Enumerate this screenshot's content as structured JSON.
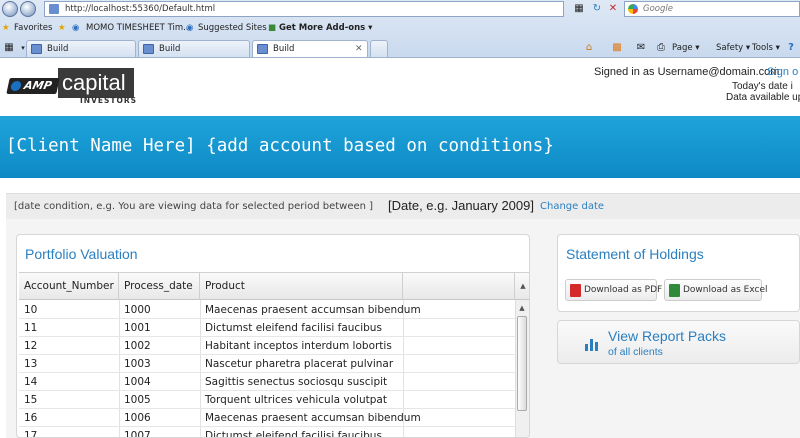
{
  "browser": {
    "address": "http://localhost:55360/Default.html",
    "search_placeholder": "Google",
    "favorites_label": "Favorites",
    "bookmarks": [
      "MOMO  TIMESHEET  Tim...",
      "Suggested Sites ▾",
      "Get More Add-ons ▾"
    ],
    "tabs": [
      "Build",
      "Build",
      "Build"
    ],
    "commands": [
      "Page ▾",
      "Safety ▾",
      "Tools ▾"
    ]
  },
  "header": {
    "logo_amp": "AMP",
    "logo_capital": "capital",
    "logo_investors": "INVESTORS",
    "signed_in": "Signed in as  Username@domain.com",
    "sign_out": "Sign o",
    "today": "Today's date i",
    "available": "Data available up t"
  },
  "banner": {
    "title": "[Client Name Here] {add account based on conditions}"
  },
  "date_bar": {
    "condition": "[date condition, e.g. You are viewing data for selected period between ]",
    "date": "[Date, e.g. January 2009]",
    "change": "Change date"
  },
  "portfolio": {
    "title": "Portfolio Valuation",
    "columns": [
      "Account_Number",
      "Process_date",
      "Product"
    ],
    "rows": [
      [
        "10",
        "1000",
        "Maecenas praesent accumsan bibendum"
      ],
      [
        "11",
        "1001",
        "Dictumst eleifend facilisi faucibus"
      ],
      [
        "12",
        "1002",
        "Habitant inceptos interdum lobortis"
      ],
      [
        "13",
        "1003",
        "Nascetur pharetra placerat pulvinar"
      ],
      [
        "14",
        "1004",
        "Sagittis senectus sociosqu suscipit"
      ],
      [
        "15",
        "1005",
        "Torquent ultrices vehicula volutpat"
      ],
      [
        "16",
        "1006",
        "Maecenas praesent accumsan bibendum"
      ],
      [
        "17",
        "1007",
        "Dictumst eleifend facilisi faucibus"
      ]
    ]
  },
  "statement": {
    "title": "Statement of Holdings",
    "pdf_label": "Download as PDF",
    "excel_label": "Download as Excel"
  },
  "report_packs": {
    "title": "View Report Packs",
    "subtitle": "of all clients"
  },
  "colors": {
    "banner": "#1a9ad4",
    "link": "#2a7fc0"
  }
}
